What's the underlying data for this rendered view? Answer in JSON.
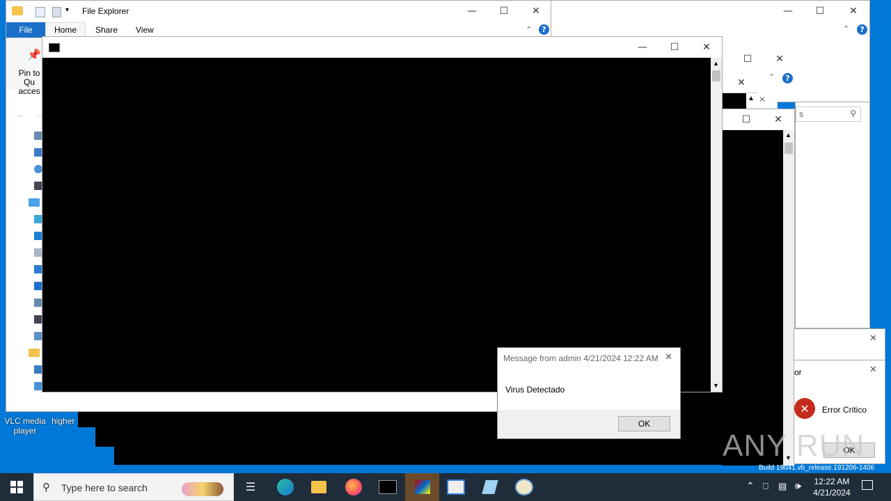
{
  "explorer": {
    "title": "File Explorer",
    "tabs": [
      "File",
      "Home",
      "Share",
      "View"
    ],
    "pin_label_1": "Pin to Qu",
    "pin_label_2": "acces"
  },
  "search_box": {
    "text": "s"
  },
  "desktop": {
    "icons": [
      {
        "label_1": "VLC media",
        "label_2": "player"
      },
      {
        "label_1": "higher",
        "label_2": ""
      }
    ]
  },
  "message_box": {
    "title": "Message from admin 4/21/2024 12:22 AM",
    "body": "Virus Detectado",
    "ok": "OK"
  },
  "error_dialog": {
    "title_fragment": "or",
    "message": "Error Critico",
    "ok": "OK"
  },
  "watermark": {
    "text": "ANY RUN",
    "build": "Build 19041.vb_release.191206-1406"
  },
  "taskbar": {
    "search_placeholder": "Type here to search",
    "time": "12:22 AM",
    "date": "4/21/2024"
  },
  "colors": {
    "desktop": "#0078d7",
    "taskbar": "#1f2d3a",
    "accent": "#1a6fc8",
    "error": "#c42b1c"
  }
}
